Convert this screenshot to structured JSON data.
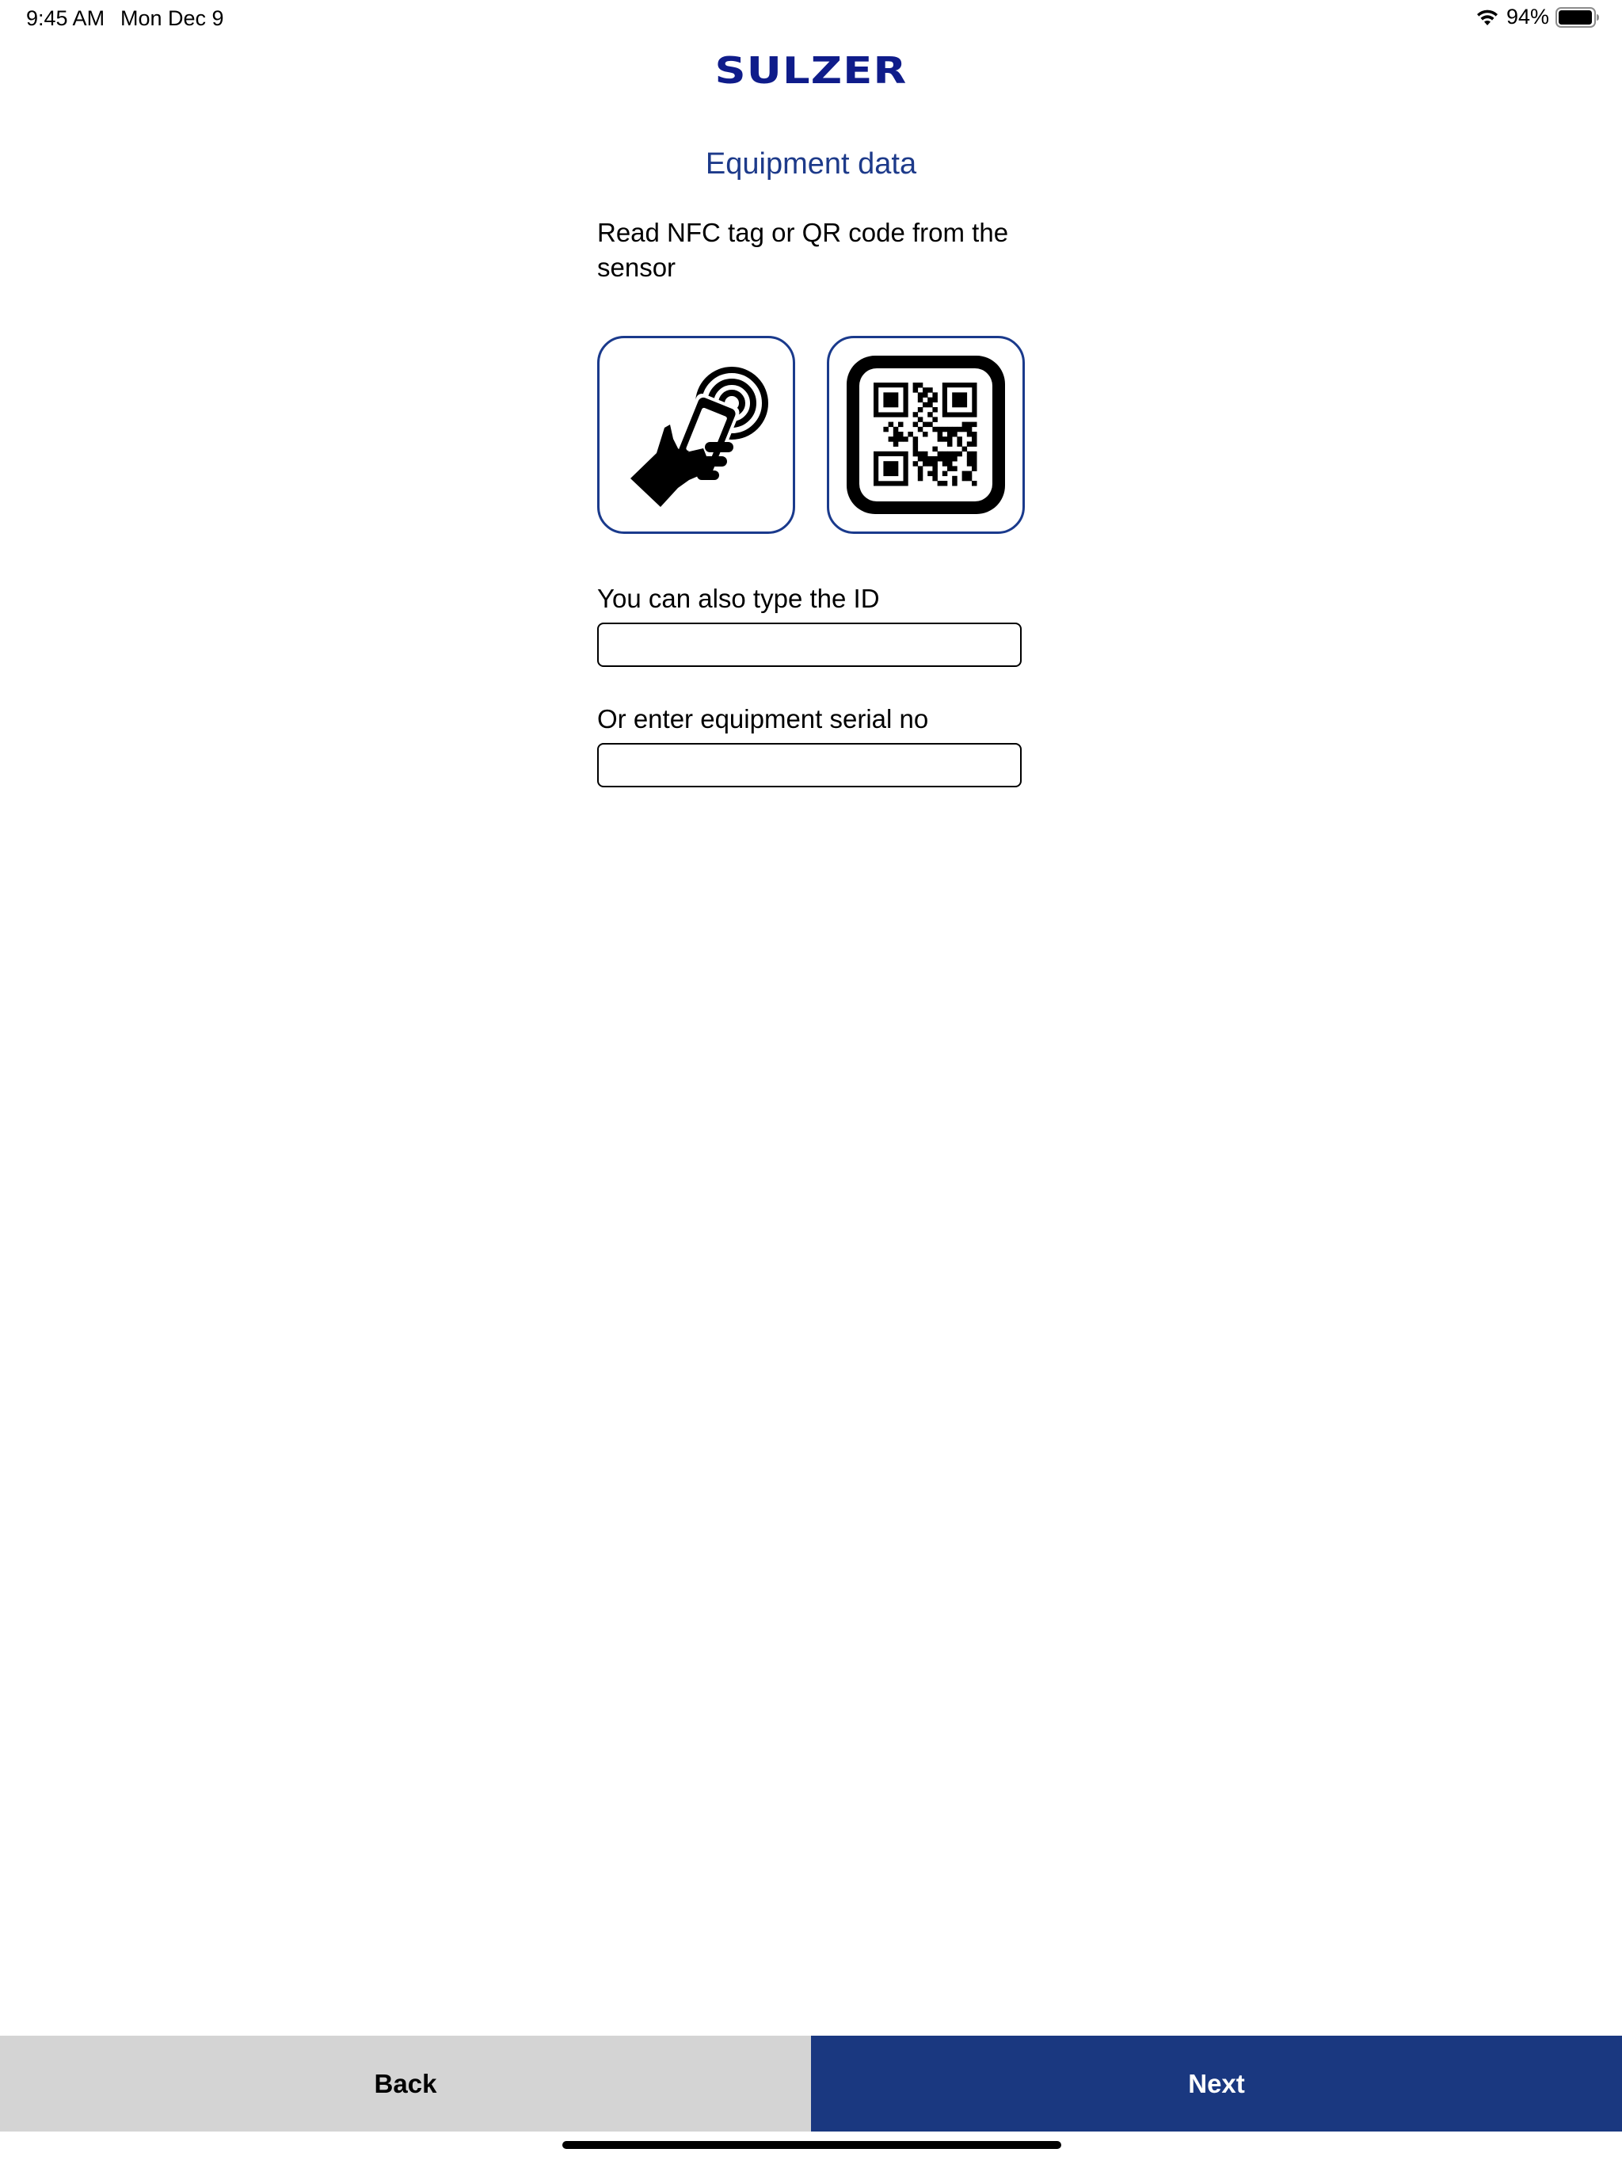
{
  "status_bar": {
    "time": "9:45 AM",
    "date": "Mon Dec 9",
    "battery_percent": "94%"
  },
  "header": {
    "logo_text": "SULZER",
    "title": "Equipment data"
  },
  "main": {
    "instructions": "Read NFC tag or QR code from the sensor",
    "nfc_button_icon": "nfc-phone-hand-icon",
    "qr_button_icon": "qr-code-icon",
    "id_field": {
      "label": "You can also type the ID",
      "value": "",
      "placeholder": ""
    },
    "serial_field": {
      "label": "Or enter equipment serial no",
      "value": "",
      "placeholder": ""
    }
  },
  "footer": {
    "back_label": "Back",
    "next_label": "Next"
  },
  "colors": {
    "brand": "#0f1c8a",
    "title": "#1d3a8a",
    "button_border": "#1a3a8c",
    "next_bg": "#1a3880",
    "back_bg": "#d4d4d4"
  }
}
